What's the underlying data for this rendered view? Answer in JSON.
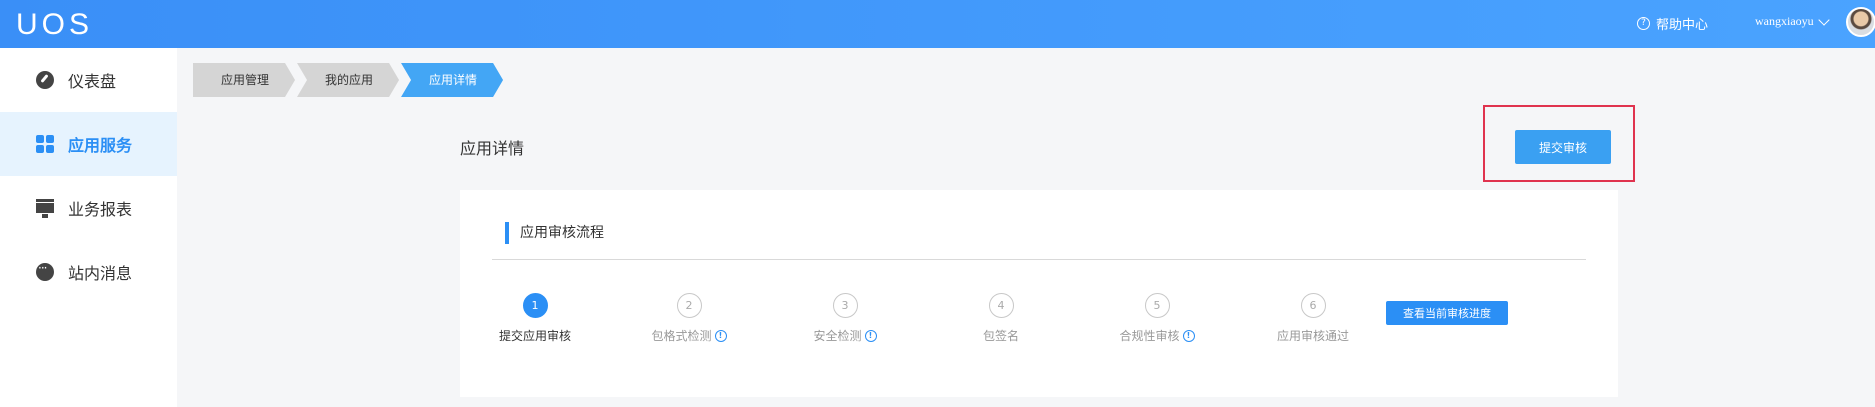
{
  "header": {
    "logo": "UOS",
    "help_label": "帮助中心",
    "help_icon": "question-circle-icon",
    "username": "wangxiaoyu",
    "brand_color": "#3a8ff7"
  },
  "sidebar": {
    "items": [
      {
        "label": "仪表盘",
        "icon": "dashboard-icon",
        "active": false
      },
      {
        "label": "应用服务",
        "icon": "grid-icon",
        "active": true
      },
      {
        "label": "业务报表",
        "icon": "report-icon",
        "active": false
      },
      {
        "label": "站内消息",
        "icon": "message-icon",
        "active": false
      }
    ]
  },
  "breadcrumb": [
    "应用管理",
    "我的应用",
    "应用详情"
  ],
  "main": {
    "title": "应用详情",
    "submit_label": "提交审核"
  },
  "review": {
    "section_title": "应用审核流程",
    "steps": [
      {
        "num": "1",
        "label": "提交应用审核",
        "done": true,
        "info": false
      },
      {
        "num": "2",
        "label": "包格式检测",
        "done": false,
        "info": true
      },
      {
        "num": "3",
        "label": "安全检测",
        "done": false,
        "info": true
      },
      {
        "num": "4",
        "label": "包签名",
        "done": false,
        "info": false
      },
      {
        "num": "5",
        "label": "合规性审核",
        "done": false,
        "info": true
      },
      {
        "num": "6",
        "label": "应用审核通过",
        "done": false,
        "info": false
      }
    ],
    "progress_button": "查看当前审核进度"
  }
}
